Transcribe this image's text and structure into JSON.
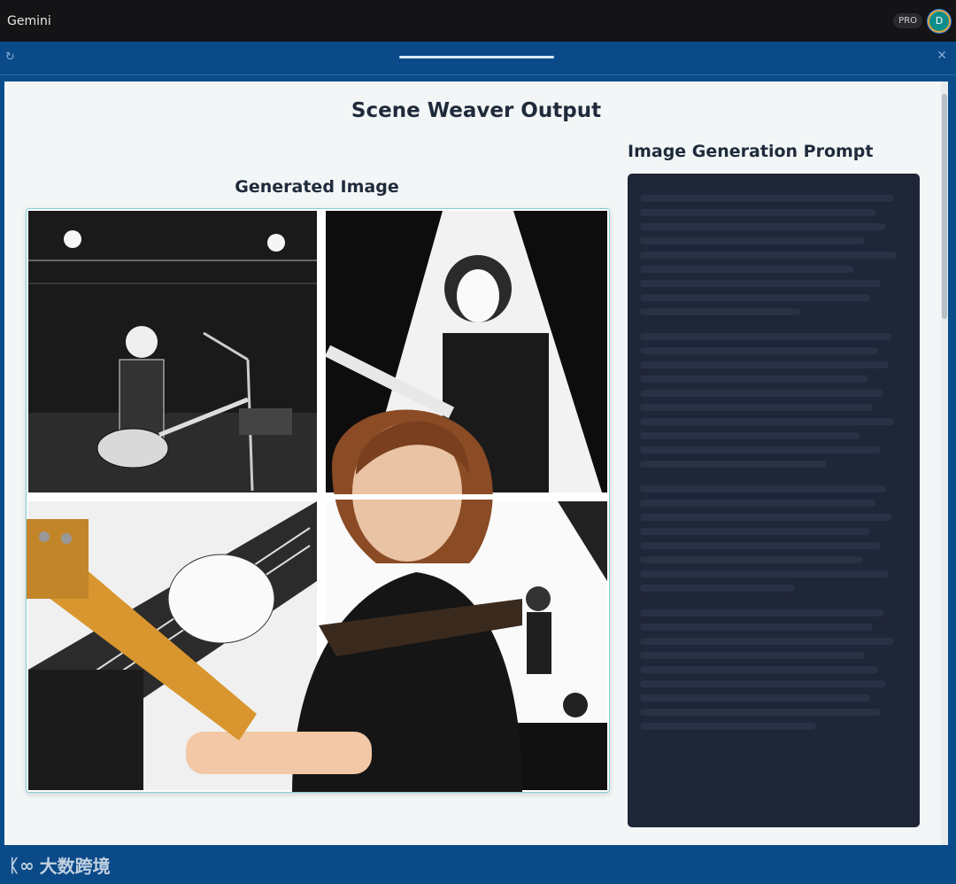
{
  "app": {
    "title": "Gemini",
    "plan_badge": "PRO",
    "avatar_letter": "D"
  },
  "progress": {
    "value": 0.2
  },
  "panel": {
    "heading": "Scene Weaver Output",
    "image_section_title": "Generated Image",
    "prompt_section_title": "Image Generation Prompt"
  },
  "footer": {
    "watermark": "大数跨境"
  },
  "colors": {
    "topbar": "#141416",
    "accent_blue": "#0b4a88",
    "panel_bg": "#f3f6f6",
    "prompt_bg": "#1f2637",
    "heading_text": "#1f2a3b"
  },
  "icons": [
    "refresh-icon",
    "close-icon",
    "avatar",
    "logo-icon"
  ]
}
